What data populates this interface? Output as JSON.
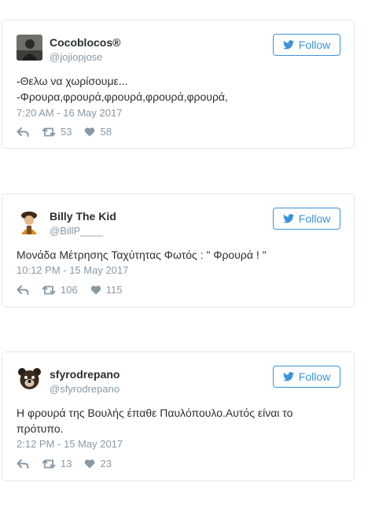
{
  "tweets": [
    {
      "name": "Cocoblocos®",
      "handle": "@jojiopjose",
      "text": "-Θελω να χωρίσουμε...\n-Φρουρα,φρουρά,φρουρά,φρουρά,φρουρά,",
      "time": "7:20 AM - 16 May 2017",
      "retweets": "53",
      "likes": "58",
      "follow_label": "Follow"
    },
    {
      "name": "Billy The Kid",
      "handle": "@BillP____",
      "text": "Μονάδα Μέτρησης Ταχύτητας Φωτός : \" Φρουρά ! \"",
      "time": "10:12 PM - 15 May 2017",
      "retweets": "106",
      "likes": "115",
      "follow_label": "Follow"
    },
    {
      "name": "sfyrodrepano",
      "handle": "@sfyrodrepano",
      "text": "Η φρουρά της Βουλής έπαθε Παυλόπουλο.Αυτός είναι το\nπρότυπο.",
      "time": "2:12 PM - 15 May 2017",
      "retweets": "13",
      "likes": "23",
      "follow_label": "Follow"
    }
  ],
  "colors": {
    "accent": "#3b94d9",
    "muted": "#8899a6",
    "border": "#e1e8ed"
  }
}
